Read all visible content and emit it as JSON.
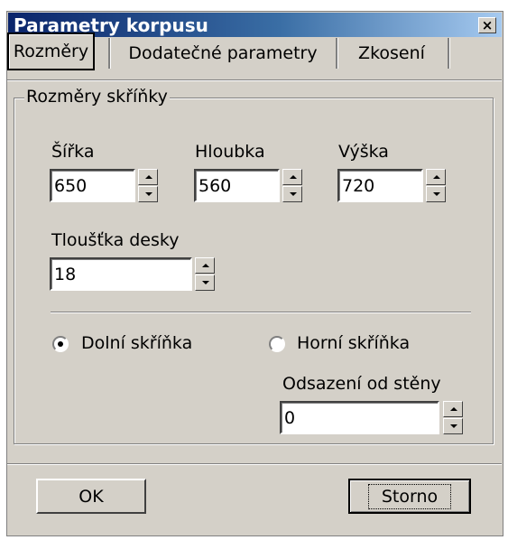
{
  "window": {
    "title": "Parametry korpusu",
    "close_glyph": "×"
  },
  "tabs": [
    {
      "label": "Rozměry",
      "active": true
    },
    {
      "label": "Dodatečné parametry",
      "active": false
    },
    {
      "label": "Zkosení",
      "active": false
    }
  ],
  "group": {
    "title": "Rozměry skříňky",
    "fields": {
      "width": {
        "label": "Šířka",
        "value": "650"
      },
      "depth": {
        "label": "Hloubka",
        "value": "560"
      },
      "height": {
        "label": "Výška",
        "value": "720"
      },
      "thickness": {
        "label": "Tloušťka desky",
        "value": "18"
      }
    },
    "radios": [
      {
        "label": "Dolní skříňka",
        "checked": true
      },
      {
        "label": "Horní skříňka",
        "checked": false
      }
    ],
    "offset": {
      "label": "Odsazení od stěny",
      "value": "0"
    }
  },
  "buttons": {
    "ok": "OK",
    "cancel": "Storno"
  }
}
